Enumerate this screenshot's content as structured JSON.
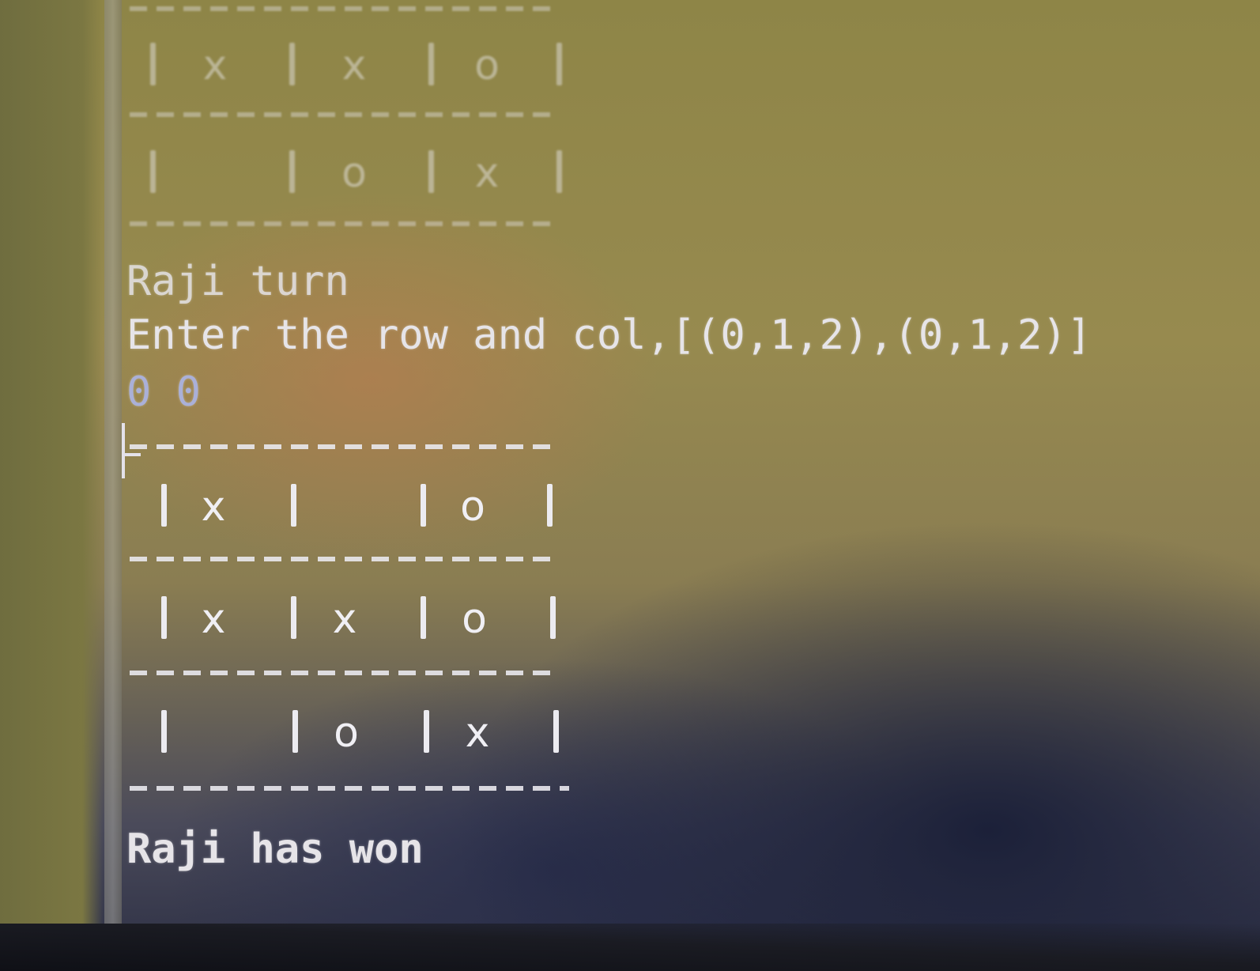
{
  "console": {
    "prev_board": {
      "rows": [
        [
          "x",
          "x",
          "o"
        ],
        [
          "",
          "o",
          "x"
        ]
      ]
    },
    "turn_line": "Raji turn",
    "prompt_line": "Enter the row and col,[(0,1,2),(0,1,2)]",
    "user_input": "0 0",
    "board": {
      "rows": [
        [
          "x",
          "",
          "o"
        ],
        [
          "x",
          "x",
          "o"
        ],
        [
          "",
          "o",
          "x"
        ]
      ]
    },
    "result_line": "Raji has won"
  }
}
